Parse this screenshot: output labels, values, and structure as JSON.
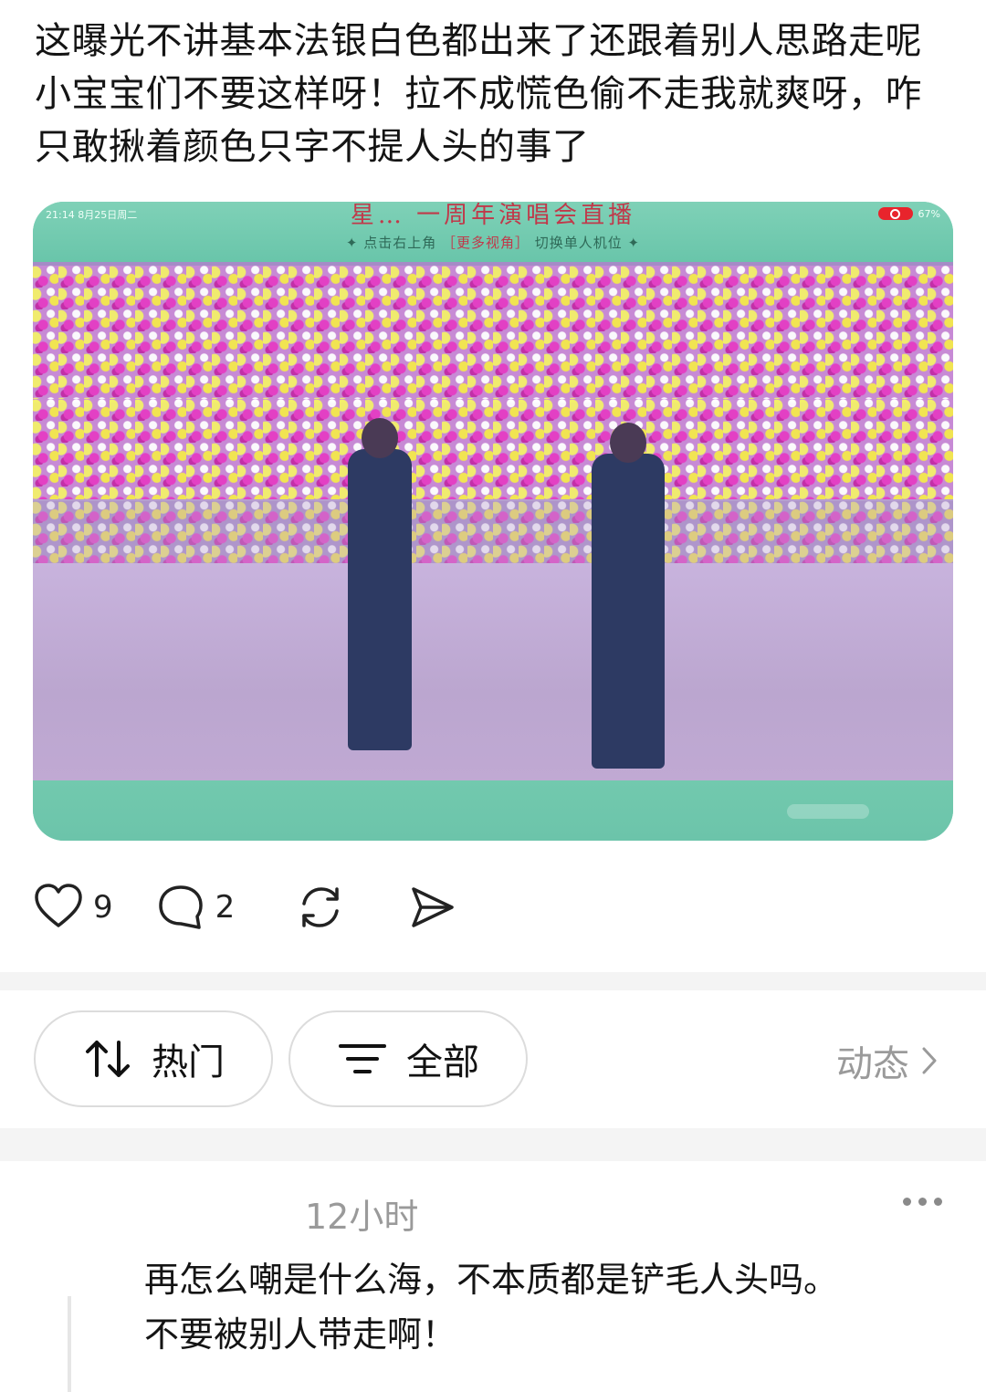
{
  "post": {
    "text": "这曝光不讲基本法银白色都出来了还跟着别人思路走呢  小宝宝们不要这样呀！拉不成慌色偷不走我就爽呀，咋只敢揪着颜色只字不提人头的事了"
  },
  "media": {
    "status_time": "21:14  8月25日周二",
    "status_battery": "67%",
    "banner_title": "星… 一周年演唱会直播",
    "banner_sub_prefix": "✦ 点击右上角",
    "banner_sub_highlight": "［更多视角］",
    "banner_sub_suffix": "切换单人机位 ✦"
  },
  "actions": {
    "like_count": "9",
    "comment_count": "2"
  },
  "filters": {
    "hot_label": "热门",
    "all_label": "全部",
    "dynamic_label": "动态"
  },
  "comment": {
    "time": "12小时",
    "text_line1": "再怎么嘲是什么海，不本质都是铲毛人头吗。",
    "text_line2": "不要被别人带走啊！"
  },
  "colors": {
    "accent_red": "#c0394a",
    "banner_green": "#6fc8ad",
    "muted_gray": "#9a9a9a"
  }
}
